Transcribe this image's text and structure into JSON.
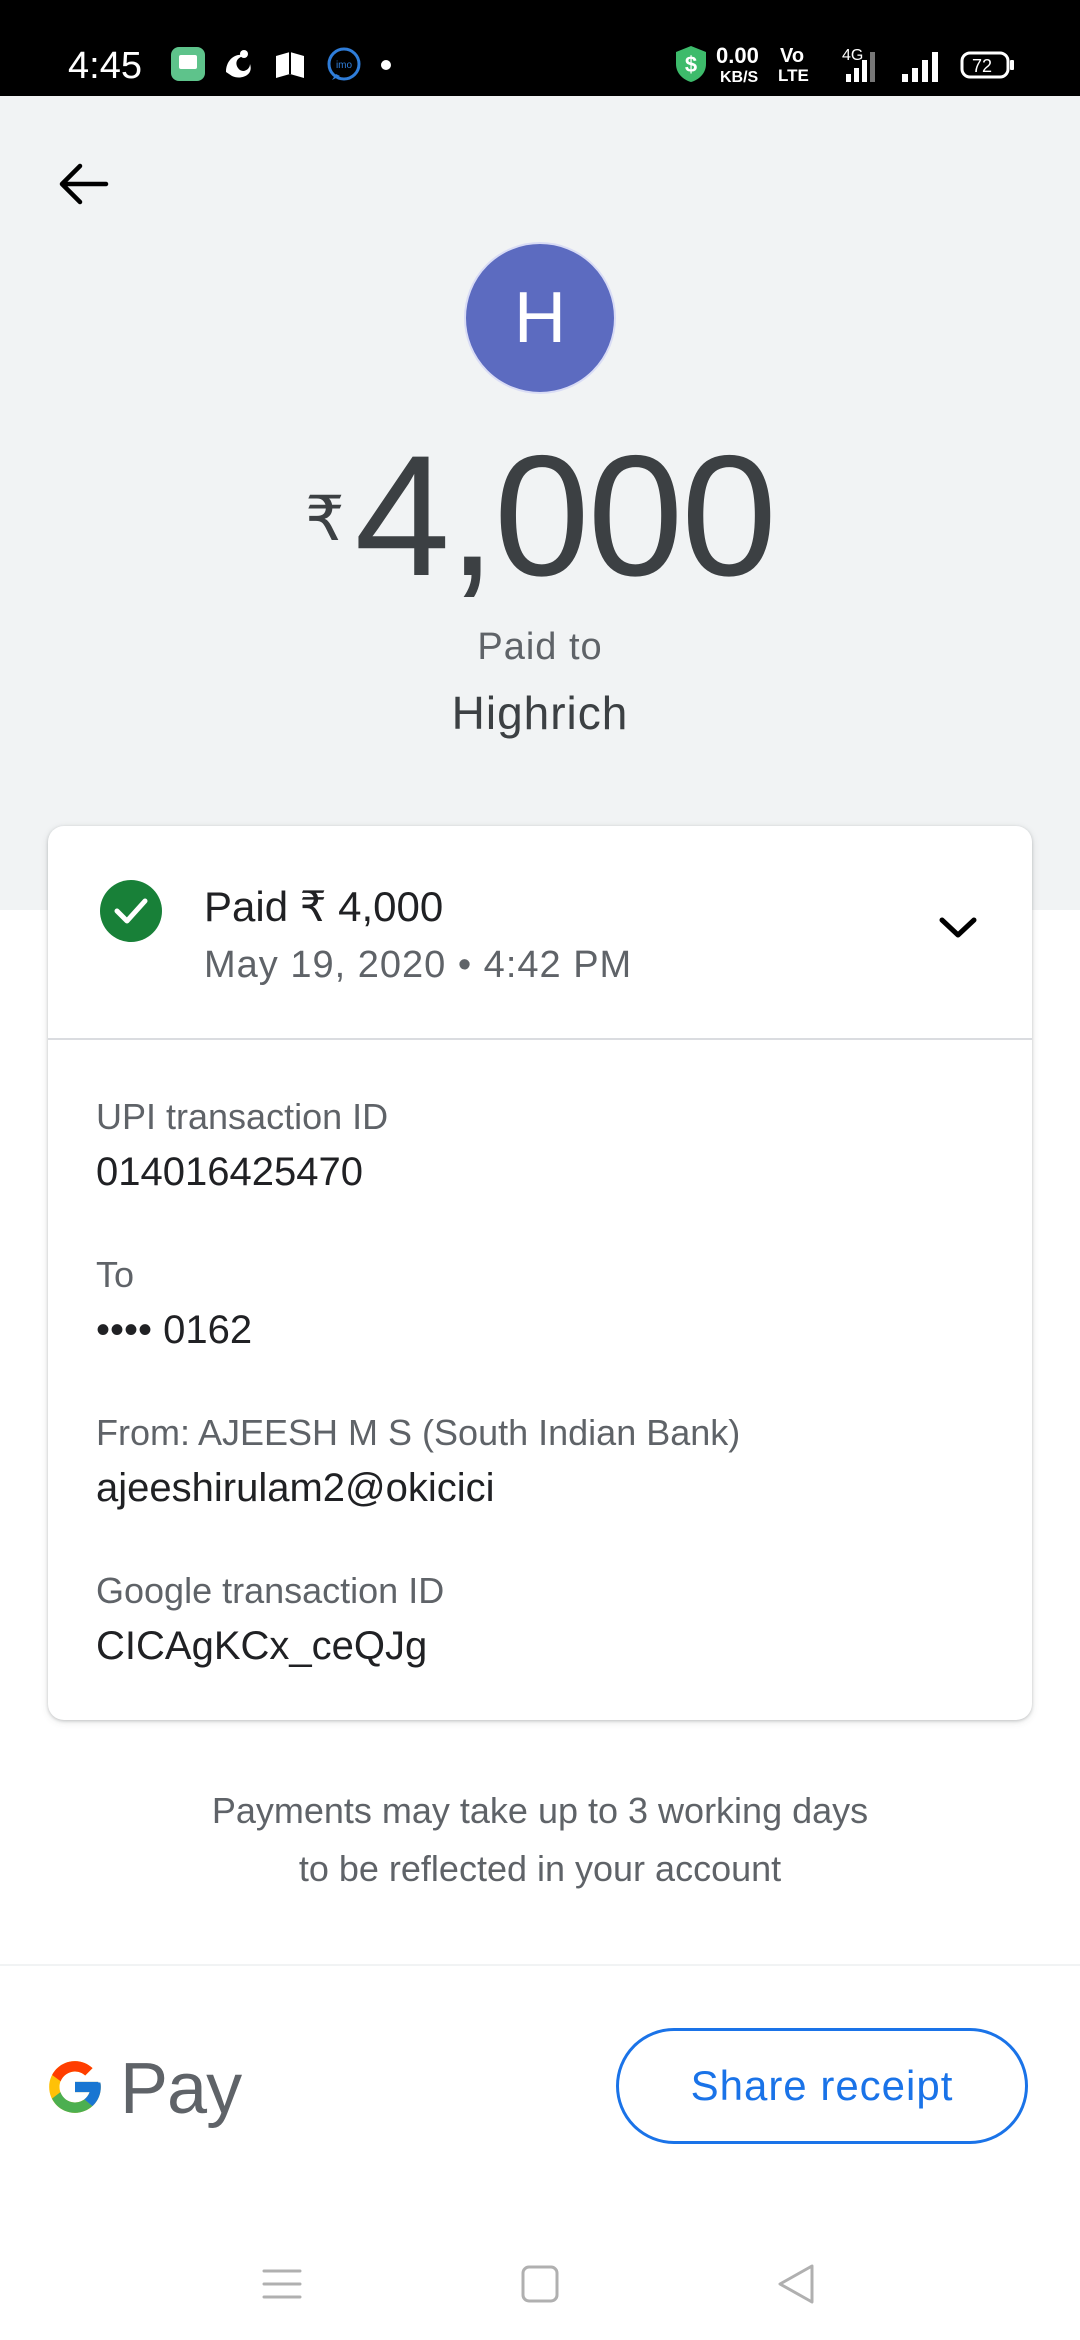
{
  "status_bar": {
    "time": "4:45",
    "net_speed_value": "0.00",
    "net_speed_unit": "KB/S",
    "volte_top": "Vo",
    "volte_bottom": "LTE",
    "network_type": "4G",
    "battery": "72",
    "icons": [
      "messages-icon",
      "uc-browser-icon",
      "news-app-icon",
      "imo-icon",
      "notification-dot-icon",
      "security-shield-icon",
      "signal-icon",
      "signal-icon-2",
      "battery-icon"
    ]
  },
  "header": {
    "back_icon": "arrow-back-icon",
    "avatar_letter": "H",
    "avatar_color": "#5c6bc0",
    "currency_symbol": "₹",
    "amount": "4,000",
    "paid_to_label": "Paid to",
    "payee_name": "Highrich"
  },
  "card": {
    "status_title": "Paid ₹ 4,000",
    "datetime": "May 19, 2020 • 4:42 PM",
    "status_color": "#188038",
    "details": [
      {
        "label": "UPI transaction ID",
        "value": "014016425470"
      },
      {
        "label": "To",
        "value": "•••• 0162"
      },
      {
        "label": "From: AJEESH M S (South Indian Bank)",
        "value": "ajeeshirulam2@okicici"
      },
      {
        "label": "Google transaction ID",
        "value": "CICAgKCx_ceQJg"
      }
    ]
  },
  "note": {
    "line1": "Payments may take up to 3 working days",
    "line2": "to be reflected in your account"
  },
  "footer": {
    "logo_text": "Pay",
    "share_label": "Share receipt",
    "accent_color": "#1a73e8"
  },
  "nav_bar": {
    "icons": [
      "menu-icon",
      "home-square-icon",
      "back-triangle-icon"
    ]
  }
}
